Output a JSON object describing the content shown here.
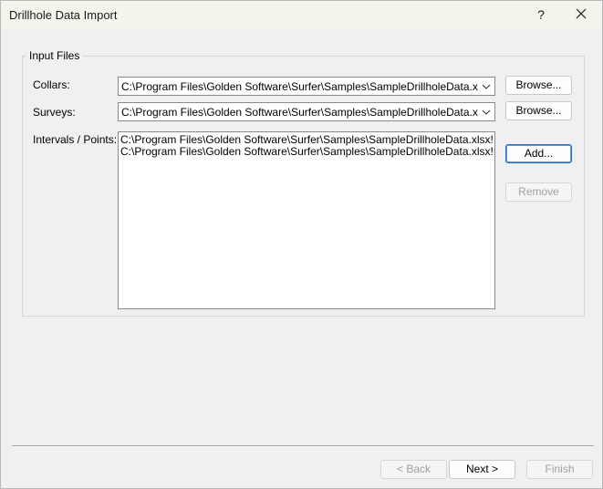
{
  "window": {
    "title": "Drillhole Data Import",
    "help_label": "?"
  },
  "group": {
    "legend": "Input Files"
  },
  "collars": {
    "label": "Collars:",
    "value": "C:\\Program Files\\Golden Software\\Surfer\\Samples\\SampleDrillholeData.xlsx!Collar",
    "browse_label": "Browse..."
  },
  "surveys": {
    "label": "Surveys:",
    "value": "C:\\Program Files\\Golden Software\\Surfer\\Samples\\SampleDrillholeData.xlsx!Survey",
    "browse_label": "Browse..."
  },
  "intervals": {
    "label": "Intervals / Points:",
    "items": [
      "C:\\Program Files\\Golden Software\\Surfer\\Samples\\SampleDrillholeData.xlsx!Interval",
      "C:\\Program Files\\Golden Software\\Surfer\\Samples\\SampleDrillholeData.xlsx!Point"
    ],
    "add_label": "Add...",
    "remove_label": "Remove"
  },
  "footer": {
    "back_label": "< Back",
    "next_label": "Next >",
    "finish_label": "Finish"
  },
  "icons": {
    "close": "close-icon",
    "dropdown": "chevron-down-icon"
  }
}
